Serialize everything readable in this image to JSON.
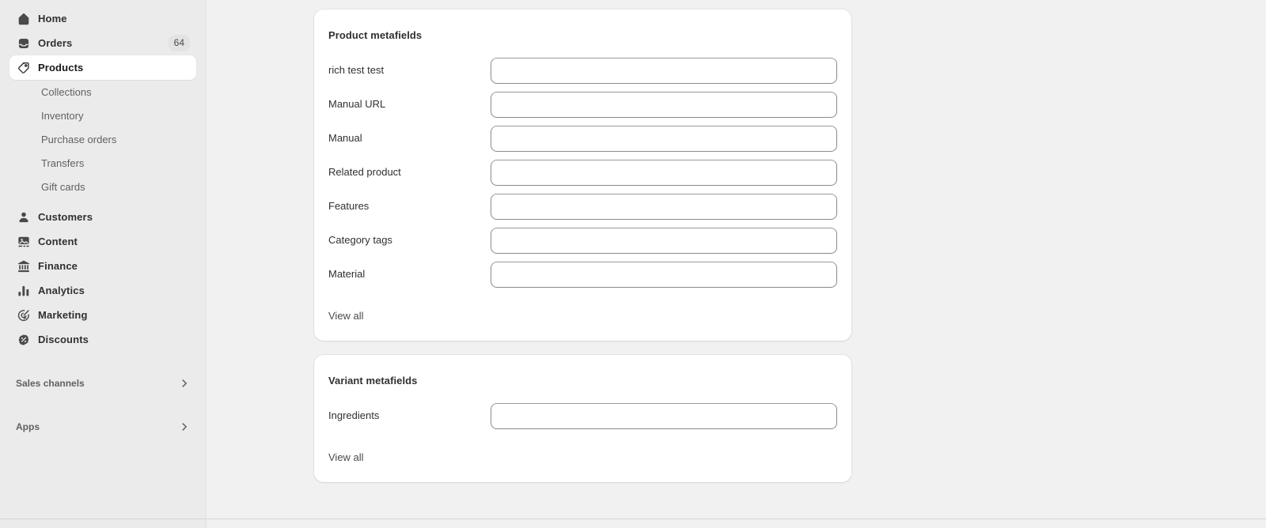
{
  "sidebar": {
    "primary_items": [
      {
        "label": "Home",
        "icon": "home-icon",
        "badge": null
      },
      {
        "label": "Orders",
        "icon": "orders-inbox-icon",
        "badge": "64"
      },
      {
        "label": "Products",
        "icon": "product-tag-icon",
        "badge": null,
        "active": true
      }
    ],
    "product_sub_items": [
      {
        "label": "Collections"
      },
      {
        "label": "Inventory"
      },
      {
        "label": "Purchase orders"
      },
      {
        "label": "Transfers"
      },
      {
        "label": "Gift cards"
      }
    ],
    "secondary_items": [
      {
        "label": "Customers",
        "icon": "person-icon"
      },
      {
        "label": "Content",
        "icon": "image-content-icon"
      },
      {
        "label": "Finance",
        "icon": "bank-icon"
      },
      {
        "label": "Analytics",
        "icon": "bar-chart-icon"
      },
      {
        "label": "Marketing",
        "icon": "target-cursor-icon"
      },
      {
        "label": "Discounts",
        "icon": "discount-percent-icon"
      }
    ],
    "sections": [
      {
        "label": "Sales channels",
        "icon": "chevron-right-icon"
      },
      {
        "label": "Apps",
        "icon": "chevron-right-icon"
      }
    ]
  },
  "main": {
    "cards": [
      {
        "title": "Product metafields",
        "fields": [
          {
            "label": "rich test test",
            "value": "",
            "placeholder": ""
          },
          {
            "label": "Manual URL",
            "value": "",
            "placeholder": ""
          },
          {
            "label": "Manual",
            "value": "",
            "placeholder": ""
          },
          {
            "label": "Related product",
            "value": "",
            "placeholder": ""
          },
          {
            "label": "Features",
            "value": "",
            "placeholder": ""
          },
          {
            "label": "Category tags",
            "value": "",
            "placeholder": ""
          },
          {
            "label": "Material",
            "value": "",
            "placeholder": ""
          }
        ],
        "footer_link": "View all"
      },
      {
        "title": "Variant metafields",
        "fields": [
          {
            "label": "Ingredients",
            "value": "",
            "placeholder": ""
          }
        ],
        "footer_link": "View all"
      }
    ]
  },
  "colors": {
    "sidebar_bg": "#ebebeb",
    "main_bg": "#f1f1f1",
    "card_bg": "#ffffff",
    "text_primary": "#303030",
    "text_secondary": "#616161",
    "input_border": "#8a8a8a",
    "badge_bg": "#e3e3e3"
  }
}
